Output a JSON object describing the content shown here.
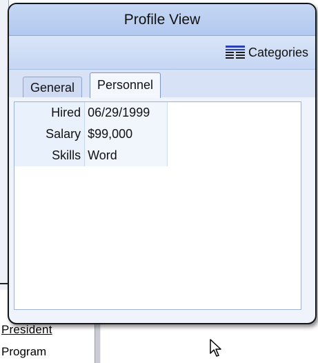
{
  "popup": {
    "title": "Profile View",
    "toolbar": {
      "categories_label": "Categories",
      "categories_icon": "categories-list-icon"
    },
    "tabs": [
      {
        "label": "General",
        "active": false
      },
      {
        "label": "Personnel",
        "active": true
      }
    ],
    "properties": [
      {
        "label": "Hired",
        "value": "06/29/1999"
      },
      {
        "label": "Salary",
        "value": "$99,000"
      },
      {
        "label": "Skills",
        "value": "Word"
      }
    ]
  },
  "background": {
    "fragment_1": "President",
    "fragment_2": "Program"
  },
  "colors": {
    "title_bar": "#b9cdf1",
    "toolbar": "#cfddf5",
    "tab_active": "#f4f8fe",
    "icon_blue": "#2b3fb6"
  }
}
